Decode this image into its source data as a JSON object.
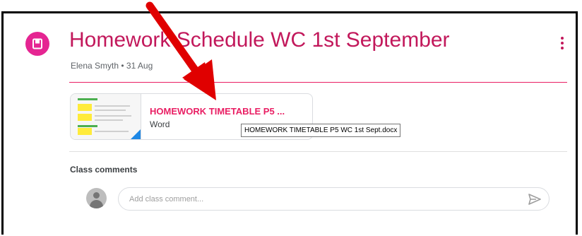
{
  "assignment": {
    "title": "Homework Schedule WC 1st September",
    "meta": "Elena Smyth • 31 Aug",
    "icon": "assignment-icon",
    "accent_color": "#c2185b"
  },
  "attachment": {
    "file_name": "HOMEWORK TIMETABLE P5 ...",
    "file_type": "Word",
    "tooltip": "HOMEWORK TIMETABLE P5 WC 1st Sept.docx"
  },
  "comments": {
    "heading": "Class comments",
    "placeholder": "Add class comment..."
  },
  "annotation": {
    "arrow_color": "#e00000"
  }
}
